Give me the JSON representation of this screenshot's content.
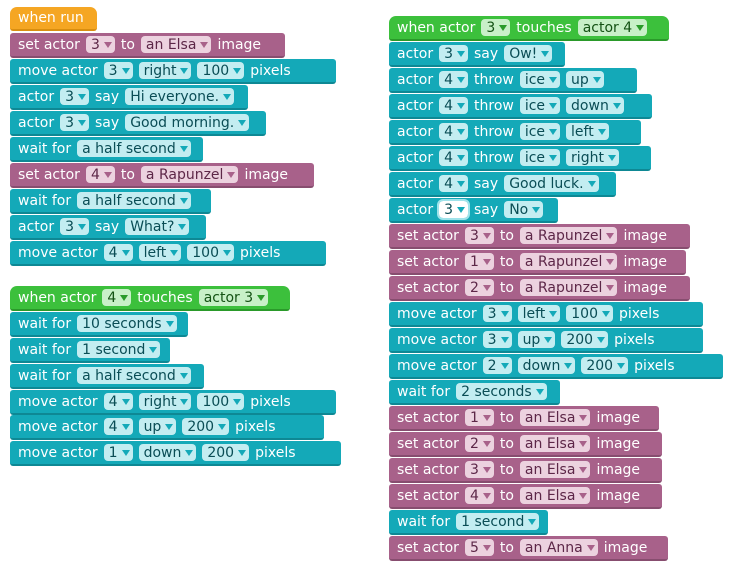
{
  "stack1": {
    "b0": {
      "w": [
        "when run"
      ]
    },
    "b1": {
      "w": [
        "set actor",
        "to",
        "image"
      ],
      "d": [
        "3",
        "an Elsa"
      ]
    },
    "b2": {
      "w": [
        "move actor",
        "pixels"
      ],
      "d": [
        "3",
        "right",
        "100"
      ]
    },
    "b3": {
      "w": [
        "actor",
        "say"
      ],
      "d": [
        "3",
        "Hi everyone."
      ]
    },
    "b4": {
      "w": [
        "actor",
        "say"
      ],
      "d": [
        "3",
        "Good morning."
      ]
    },
    "b5": {
      "w": [
        "wait for"
      ],
      "d": [
        "a half second"
      ]
    },
    "b6": {
      "w": [
        "set actor",
        "to",
        "image"
      ],
      "d": [
        "4",
        "a Rapunzel"
      ]
    },
    "b7": {
      "w": [
        "wait for"
      ],
      "d": [
        "a half second"
      ]
    },
    "b8": {
      "w": [
        "actor",
        "say"
      ],
      "d": [
        "3",
        "What?"
      ]
    },
    "b9": {
      "w": [
        "move actor",
        "pixels"
      ],
      "d": [
        "4",
        "left",
        "100"
      ]
    }
  },
  "stack2": {
    "b0": {
      "w": [
        "when actor",
        "touches"
      ],
      "d": [
        "4",
        "actor 3"
      ]
    },
    "b1": {
      "w": [
        "wait for"
      ],
      "d": [
        "10 seconds"
      ]
    },
    "b2": {
      "w": [
        "wait for"
      ],
      "d": [
        "1 second"
      ]
    },
    "b3": {
      "w": [
        "wait for"
      ],
      "d": [
        "a half second"
      ]
    },
    "b4": {
      "w": [
        "move actor",
        "pixels"
      ],
      "d": [
        "4",
        "right",
        "100"
      ]
    },
    "b5": {
      "w": [
        "move actor",
        "pixels"
      ],
      "d": [
        "4",
        "up",
        "200"
      ]
    },
    "b6": {
      "w": [
        "move actor",
        "pixels"
      ],
      "d": [
        "1",
        "down",
        "200"
      ]
    }
  },
  "stack3": {
    "b0": {
      "w": [
        "when actor",
        "touches"
      ],
      "d": [
        "3",
        "actor 4"
      ]
    },
    "b1": {
      "w": [
        "actor",
        "say"
      ],
      "d": [
        "3",
        "Ow!"
      ]
    },
    "b2": {
      "w": [
        "actor",
        "throw"
      ],
      "d": [
        "4",
        "ice",
        "up"
      ]
    },
    "b3": {
      "w": [
        "actor",
        "throw"
      ],
      "d": [
        "4",
        "ice",
        "down"
      ]
    },
    "b4": {
      "w": [
        "actor",
        "throw"
      ],
      "d": [
        "4",
        "ice",
        "left"
      ]
    },
    "b5": {
      "w": [
        "actor",
        "throw"
      ],
      "d": [
        "4",
        "ice",
        "right"
      ]
    },
    "b6": {
      "w": [
        "actor",
        "say"
      ],
      "d": [
        "4",
        "Good luck."
      ]
    },
    "b7": {
      "w": [
        "actor",
        "say"
      ],
      "d": [
        "3",
        "No"
      ]
    },
    "b8": {
      "w": [
        "set actor",
        "to",
        "image"
      ],
      "d": [
        "3",
        "a Rapunzel"
      ]
    },
    "b9": {
      "w": [
        "set actor",
        "to",
        "image"
      ],
      "d": [
        "1",
        "a Rapunzel"
      ]
    },
    "b10": {
      "w": [
        "set actor",
        "to",
        "image"
      ],
      "d": [
        "2",
        "a Rapunzel"
      ]
    },
    "b11": {
      "w": [
        "move actor",
        "pixels"
      ],
      "d": [
        "3",
        "left",
        "100"
      ]
    },
    "b12": {
      "w": [
        "move actor",
        "pixels"
      ],
      "d": [
        "3",
        "up",
        "200"
      ]
    },
    "b13": {
      "w": [
        "move actor",
        "pixels"
      ],
      "d": [
        "2",
        "down",
        "200"
      ]
    },
    "b14": {
      "w": [
        "wait for"
      ],
      "d": [
        "2 seconds"
      ]
    },
    "b15": {
      "w": [
        "set actor",
        "to",
        "image"
      ],
      "d": [
        "1",
        "an Elsa"
      ]
    },
    "b16": {
      "w": [
        "set actor",
        "to",
        "image"
      ],
      "d": [
        "2",
        "an Elsa"
      ]
    },
    "b17": {
      "w": [
        "set actor",
        "to",
        "image"
      ],
      "d": [
        "3",
        "an Elsa"
      ]
    },
    "b18": {
      "w": [
        "set actor",
        "to",
        "image"
      ],
      "d": [
        "4",
        "an Elsa"
      ]
    },
    "b19": {
      "w": [
        "wait for"
      ],
      "d": [
        "1 second"
      ]
    },
    "b20": {
      "w": [
        "set actor",
        "to",
        "image"
      ],
      "d": [
        "5",
        "an Anna"
      ]
    }
  },
  "colors": {
    "event": "#f5a623",
    "event_touch": "#3cc03c",
    "motion": "#14a9b8",
    "looks": "#a8618a"
  }
}
